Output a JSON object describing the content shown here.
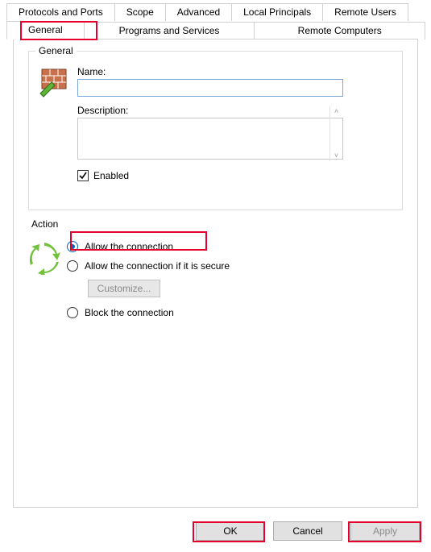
{
  "tabs": {
    "row1": [
      "Protocols and Ports",
      "Scope",
      "Advanced",
      "Local Principals",
      "Remote Users"
    ],
    "row2": [
      "General",
      "Programs and Services",
      "Remote Computers"
    ],
    "active": "General"
  },
  "general_group": {
    "legend": "General",
    "name_label": "Name:",
    "name_value": "",
    "description_label": "Description:",
    "description_value": "",
    "enabled_label": "Enabled",
    "enabled_checked": true
  },
  "action_group": {
    "legend": "Action",
    "options": {
      "allow": "Allow the connection",
      "allow_secure": "Allow the connection if it is secure",
      "block": "Block the connection"
    },
    "selected": "allow",
    "customize_label": "Customize...",
    "customize_enabled": false
  },
  "buttons": {
    "ok": "OK",
    "cancel": "Cancel",
    "apply": "Apply",
    "apply_enabled": false
  },
  "highlights": [
    "general_tab",
    "allow_option",
    "ok_button",
    "apply_button"
  ]
}
